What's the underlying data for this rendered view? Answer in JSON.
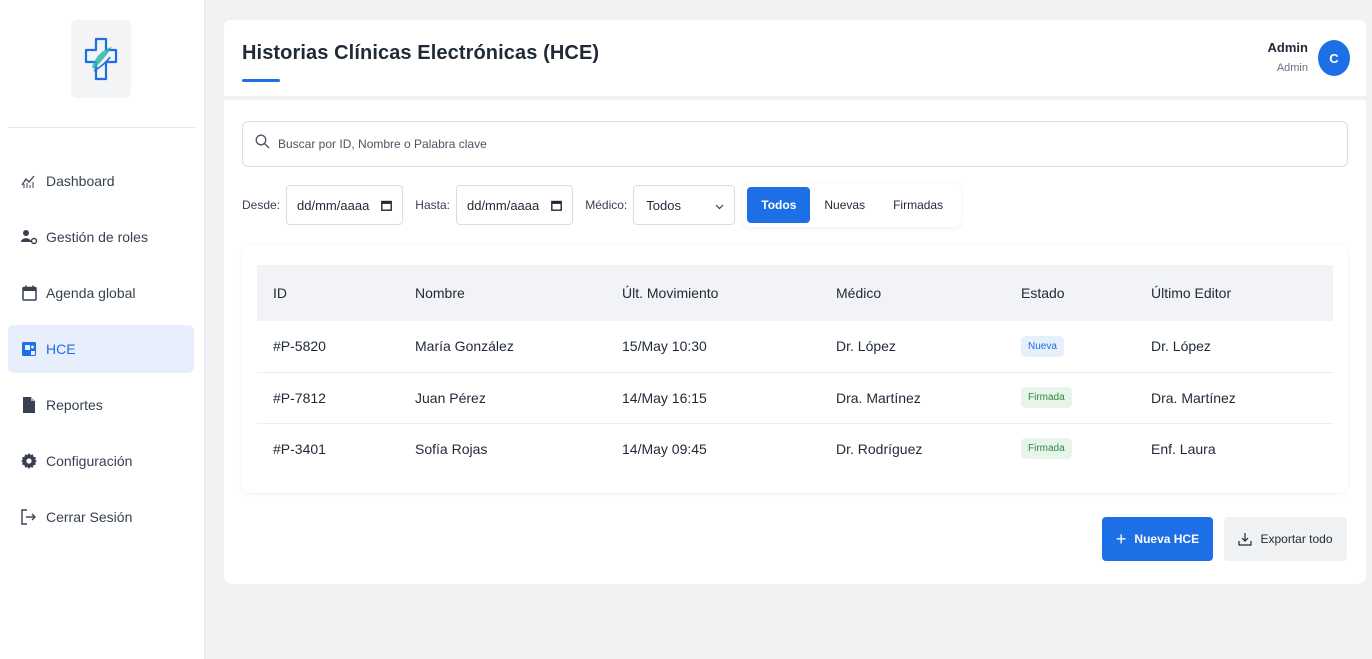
{
  "sidebar": {
    "logo_icon": "medical-cross-logo",
    "items": [
      {
        "label": "Dashboard",
        "icon": "chart-icon",
        "active": false
      },
      {
        "label": "Gestión de roles",
        "icon": "users-gear-icon",
        "active": false
      },
      {
        "label": "Agenda global",
        "icon": "calendar-icon",
        "active": false
      },
      {
        "label": "HCE",
        "icon": "records-icon",
        "active": true
      },
      {
        "label": "Reportes",
        "icon": "file-icon",
        "active": false
      },
      {
        "label": "Configuración",
        "icon": "gear-icon",
        "active": false
      },
      {
        "label": "Cerrar Sesión",
        "icon": "logout-icon",
        "active": false
      }
    ]
  },
  "header": {
    "title": "Historias Clínicas Electrónicas (HCE)",
    "user_name": "Admin",
    "user_role": "Admin",
    "avatar_initial": "C"
  },
  "search": {
    "placeholder": "Buscar por ID, Nombre o Palabra clave"
  },
  "filters": {
    "desde_label": "Desde:",
    "desde_value": "dd/mm/aaaa",
    "hasta_label": "Hasta:",
    "hasta_value": "dd/mm/aaaa",
    "medico_label": "Médico:",
    "medico_value": "Todos",
    "tabs": [
      "Todos",
      "Nuevas",
      "Firmadas"
    ],
    "active_tab": "Todos"
  },
  "table": {
    "headers": [
      "ID",
      "Nombre",
      "Últ. Movimiento",
      "Médico",
      "Estado",
      "Último Editor"
    ],
    "rows": [
      {
        "id": "#P-5820",
        "nombre": "María González",
        "movimiento": "15/May 10:30",
        "medico": "Dr. López",
        "estado": "Nueva",
        "editor": "Dr. López"
      },
      {
        "id": "#P-7812",
        "nombre": "Juan Pérez",
        "movimiento": "14/May 16:15",
        "medico": "Dra. Martínez",
        "estado": "Firmada",
        "editor": "Dra. Martínez"
      },
      {
        "id": "#P-3401",
        "nombre": "Sofía Rojas",
        "movimiento": "14/May 09:45",
        "medico": "Dr. Rodríguez",
        "estado": "Firmada",
        "editor": "Enf. Laura"
      }
    ]
  },
  "actions": {
    "new_label": "Nueva HCE",
    "export_label": "Exportar todo"
  },
  "colors": {
    "accent": "#1d6fe6",
    "badge_nueva_bg": "#e6f0fb",
    "badge_firmada_bg": "#e7f4e9",
    "logo_teal": "#2bb5a8"
  }
}
